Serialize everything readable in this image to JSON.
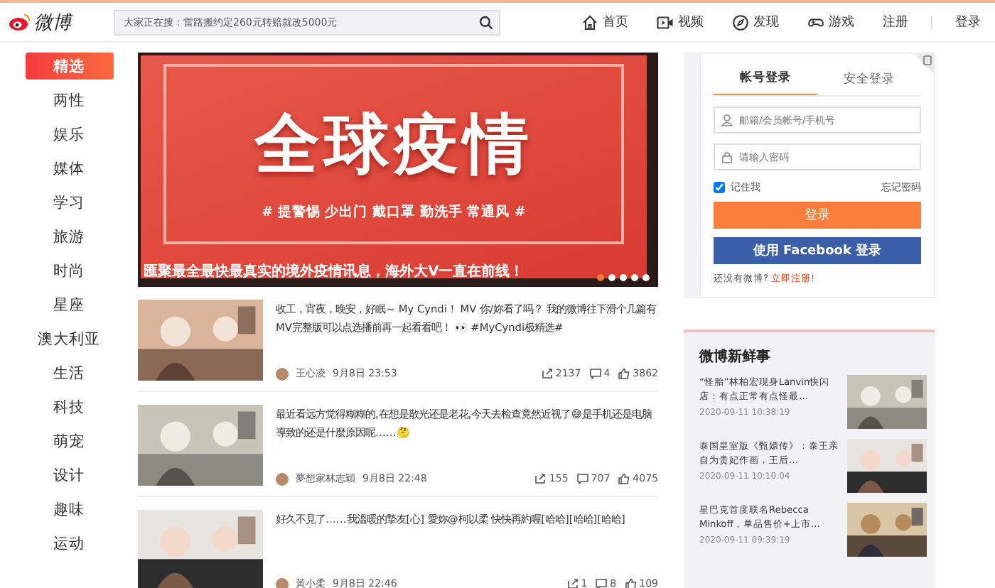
{
  "header": {
    "logo": "微博",
    "search": {
      "placeholder": "大家正在搜：雷路搬约定260元转赔就改5000元"
    },
    "nav": [
      {
        "label": "首页",
        "kind": "home"
      },
      {
        "label": "视频",
        "kind": "video"
      },
      {
        "label": "发现",
        "kind": "discover"
      },
      {
        "label": "游戏",
        "kind": "game"
      }
    ],
    "register": "注册",
    "login": "登录"
  },
  "sidebar": {
    "items": [
      {
        "label": "精选",
        "selected": true
      },
      {
        "label": "两性",
        "selected": false
      },
      {
        "label": "娱乐",
        "selected": false
      },
      {
        "label": "媒体",
        "selected": false
      },
      {
        "label": "学习",
        "selected": false
      },
      {
        "label": "旅游",
        "selected": false
      },
      {
        "label": "时尚",
        "selected": false
      },
      {
        "label": "星座",
        "selected": false
      },
      {
        "label": "澳大利亚",
        "selected": false
      },
      {
        "label": "生活",
        "selected": false
      },
      {
        "label": "科技",
        "selected": false
      },
      {
        "label": "萌宠",
        "selected": false
      },
      {
        "label": "设计",
        "selected": false
      },
      {
        "label": "趣味",
        "selected": false
      },
      {
        "label": "运动",
        "selected": false
      }
    ]
  },
  "banner": {
    "headline": "全球疫情",
    "tagline": "# 提警惕 少出门 戴口罩 勤洗手 常通风 #",
    "caption": "匯聚最全最快最真实的境外疫情讯息，海外大V一直在前线！",
    "dots": [
      {
        "selected": true
      },
      {
        "selected": false
      },
      {
        "selected": false
      },
      {
        "selected": false
      },
      {
        "selected": false
      }
    ]
  },
  "feed": [
    {
      "text": "收工，宵夜，晚安，好眠～ My Cyndi！ MV 你/妳看了吗？ 我的微博往下滑个几篇有MV完整版可以点选播前再一起看看吧！ 👀 #MyCyndi极精选#",
      "author": "王心凌",
      "time": "9月8日 23:53",
      "reposts": "2137",
      "comments": "4",
      "likes": "3862"
    },
    {
      "text": "最近看远方觉得糊糊的,在想是散光还是老花,今天去检查竟然近视了😅是手机还是电脑導致的还是什麼原因呢……🤔",
      "author": "夢想家林志穎",
      "time": "9月8日 22:48",
      "reposts": "155",
      "comments": "707",
      "likes": "4075"
    },
    {
      "text": "好久不見了……我溫暖的摯友[心] 愛妳@柯以柔 快快再約喔[哈哈][哈哈][哈哈]",
      "author": "黃小柔",
      "time": "9月8日 22:46",
      "reposts": "1",
      "comments": "8",
      "likes": "109"
    }
  ],
  "login": {
    "tabs": [
      {
        "label": "帐号登录",
        "selected": true
      },
      {
        "label": "安全登录",
        "selected": false
      }
    ],
    "username": {
      "placeholder": "邮箱/会员帐号/手机号"
    },
    "password": {
      "placeholder": "请输入密码"
    },
    "remember": {
      "label": "记住我",
      "checked": true
    },
    "forgot": "忘记密码",
    "submit": "登录",
    "facebook": "使用 Facebook 登录",
    "signup_prompt": "还没有微博?",
    "signup_link": "立即注册!"
  },
  "news": {
    "title": "微博新鲜事",
    "items": [
      {
        "title": "“怪胎”林柏宏现身Lanvin快闪店：有点正常有点怪最…",
        "time": "2020-09-11 10:38:19"
      },
      {
        "title": "泰国皇室版《甄嬛传》：泰王亲自为贵妃作画，王后…",
        "time": "2020-09-11 10:10:04"
      },
      {
        "title": "星巴克首度联名Rebecca Minkoff，单品售价+上市…",
        "time": "2020-09-11 09:39:19"
      }
    ]
  }
}
